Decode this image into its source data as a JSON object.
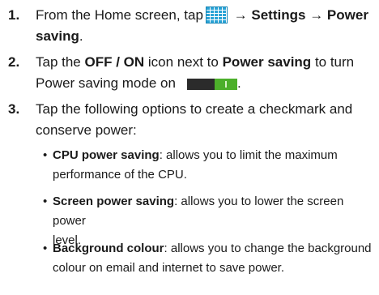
{
  "steps": [
    {
      "number": "1.",
      "line1_pre": "From the Home screen, tap",
      "icon": "apps-grid-icon",
      "arrow1": "→",
      "settings": "Settings",
      "arrow2": "→",
      "power": "Power",
      "saving": "saving",
      "period": "."
    },
    {
      "number": "2.",
      "pre": "Tap the",
      "offon": "OFF / ON",
      "mid": "icon next to",
      "ps": "Power saving",
      "post1": "to turn",
      "line2": "Power saving mode on",
      "icon": "toggle-on-icon",
      "period": "."
    },
    {
      "number": "3.",
      "line1": "Tap the following options to create a checkmark and",
      "line2": "conserve power:"
    }
  ],
  "bullets": [
    {
      "symbol": "•",
      "title": "CPU power saving",
      "line1": ": allows you to limit the maximum",
      "line2": "performance of the CPU."
    },
    {
      "symbol": "•",
      "title": "Screen power saving",
      "line1": ": allows you to lower the screen power",
      "line2": "level."
    },
    {
      "symbol": "•",
      "title": "Background colour",
      "line1": ": allows you to change the background",
      "line2": "colour on email and internet to save power."
    }
  ],
  "colors": {
    "apps_icon": "#2aa3d6",
    "toggle_off": "#2b2b2b",
    "toggle_on": "#4caf2a"
  }
}
